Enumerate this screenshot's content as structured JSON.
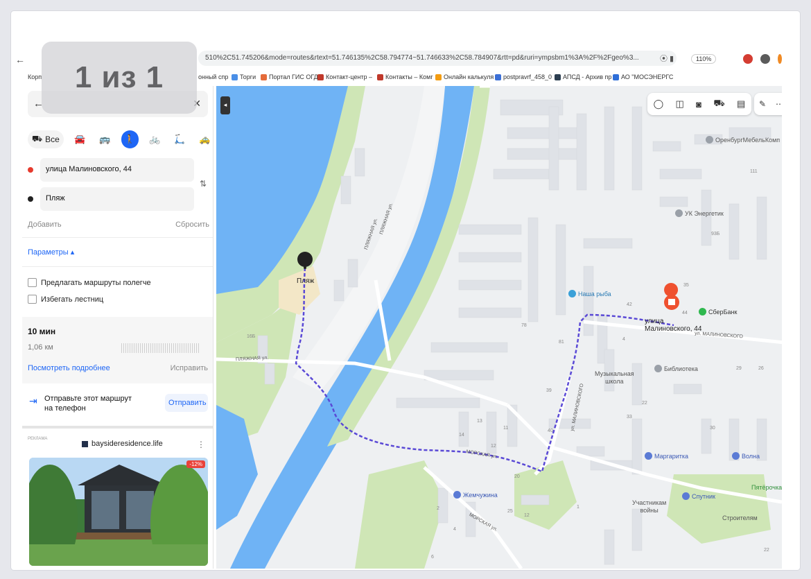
{
  "photo_counter": "1 из 1",
  "browser": {
    "url": "510%2C51.745206&mode=routes&rtext=51.746135%2C58.794774~51.746633%2C58.784907&rtt=pd&ruri=ympsbm1%3A%2F%2Fgeo%3...",
    "zoom": "110%",
    "bookmarks": [
      {
        "label": "Корп",
        "icon_color": "#ffffff"
      },
      {
        "label": "онный спр",
        "icon_color": "#ffffff"
      },
      {
        "label": "Торги",
        "icon_color": "#4a8fe7"
      },
      {
        "label": "Портал ГИС ОГД",
        "icon_color": "#e56b3a"
      },
      {
        "label": "Контакт-центр –",
        "icon_color": "#c0392b"
      },
      {
        "label": "Контакты – Комг",
        "icon_color": "#c0392b"
      },
      {
        "label": "Онлайн калькуля",
        "icon_color": "#f39c12"
      },
      {
        "label": "postpravrf_458_0",
        "icon_color": "#3b6fd6"
      },
      {
        "label": "АПСД - Архив пр",
        "icon_color": "#2c3e50"
      },
      {
        "label": "АО \"МОСЭНЕРГС",
        "icon_color": "#2f6fd8"
      }
    ]
  },
  "route_panel": {
    "modes": {
      "all_label": "Все",
      "items": [
        "car-icon",
        "bus-icon",
        "walking-icon",
        "bike-icon",
        "scooter-icon",
        "taxi-icon"
      ],
      "active": "walking-icon"
    },
    "from": "улица Малиновского, 44",
    "to": "Пляж",
    "add_label": "Добавить",
    "reset_label": "Сбросить",
    "params_label": "Параметры ▴",
    "options": [
      "Предлагать маршруты полегче",
      "Избегать лестниц"
    ],
    "route": {
      "time": "10 мин",
      "distance": "1,06 км",
      "details_link": "Посмотреть подробнее",
      "fix_link": "Исправить"
    },
    "send": {
      "text": "Отправьте этот маршрут на телефон",
      "button": "Отправить"
    },
    "ad": {
      "label": "РЕКЛАМА",
      "site": "baysideresidence.life",
      "badge": "-12%"
    }
  },
  "map": {
    "labels": {
      "beach": "Пляж",
      "destination": "улица\nМалиновского, 44",
      "orenburg": "ОренбургМебельКомп",
      "uk": "УК Энергетик",
      "nasha_ryba": "Наша рыба",
      "sberbank": "СберБанк",
      "biblioteka": "Библиотека",
      "muz_school": "Музыкальная\nшкола",
      "margarita": "Маргаритка",
      "volna": "Волна",
      "zhemchuzhina": "Жемчужина",
      "sputnik": "Спутник",
      "pyaterochka": "Пятёрочка",
      "uchastnikam": "Участникам\nвойны",
      "stroitelyam": "Строителям"
    },
    "streets": {
      "plyazhnaya1": "ПЛЯЖНАЯ ул.",
      "plyazhnaya2": "ПЛЯЖНАЯ ул.",
      "plyazhnaya3": "ПЛЯЖНАЯ ул.",
      "morskaya1": "МОРСКАЯ ул.",
      "morskaya2": "МОРСКАЯ ул.",
      "malinovskogo1": "ул. МАЛИНОВСКОГО",
      "malinovskogo2": "ул. МАЛИНОВСКОГО"
    },
    "house_numbers": [
      "111",
      "93Б",
      "42",
      "44",
      "35",
      "78",
      "81",
      "4",
      "29",
      "26",
      "39",
      "22",
      "40",
      "33",
      "30",
      "13",
      "11",
      "14",
      "12",
      "20",
      "2",
      "25",
      "4",
      "6",
      "12",
      "22",
      "1",
      "16Б"
    ]
  },
  "colors": {
    "accent": "#1e66f5",
    "water": "#6fb3f5",
    "route": "#5a49d6",
    "park": "#cfe6b6",
    "destination_pin": "#ef5130"
  }
}
